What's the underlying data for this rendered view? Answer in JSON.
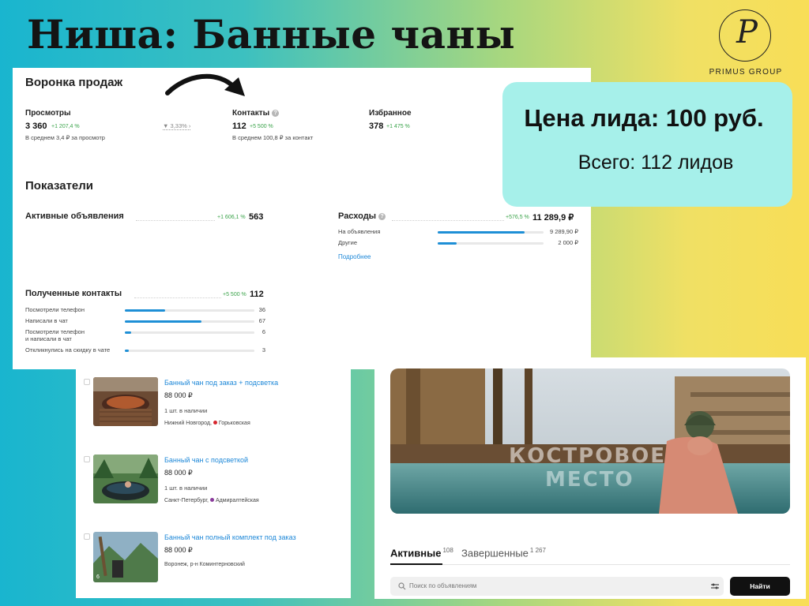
{
  "page": {
    "title": "Ниша: Банные чаны"
  },
  "logo": {
    "letter": "P",
    "text": "PRIMUS GROUP"
  },
  "funnel": {
    "title": "Воронка продаж",
    "views": {
      "label": "Просмотры",
      "value": "3 360",
      "delta": "+1 207,4 %",
      "sub": "В среднем 3,4 ₽ за просмотр"
    },
    "conversion": "3,33%",
    "contacts": {
      "label": "Контакты",
      "value": "112",
      "delta": "+5 500 %",
      "sub": "В среднем 100,8 ₽ за контакт"
    },
    "favorites": {
      "label": "Избранное",
      "value": "378",
      "delta": "+1 475 %"
    }
  },
  "metrics": {
    "title": "Показатели",
    "active_ads": {
      "label": "Активные объявления",
      "delta": "+1 606,1 %",
      "value": "563"
    },
    "expenses": {
      "label": "Расходы",
      "delta": "+576,5 %",
      "value": "11 289,9 ₽",
      "rows": [
        {
          "label": "На объявления",
          "value": "9 289,90 ₽",
          "fraction": 0.82
        },
        {
          "label": "Другие",
          "value": "2 000 ₽",
          "fraction": 0.18
        }
      ],
      "more_link": "Подробнее"
    },
    "contacts": {
      "label": "Полученные контакты",
      "delta": "+5 500 %",
      "value": "112",
      "rows": [
        {
          "label": "Посмотрели телефон",
          "value": "36",
          "fraction": 0.31
        },
        {
          "label": "Написали в чат",
          "value": "67",
          "fraction": 0.59
        },
        {
          "label": "Посмотрели телефон\nи написали в чат",
          "value": "6",
          "fraction": 0.05
        },
        {
          "label": "Откликнулись на скидку в чате",
          "value": "3",
          "fraction": 0.03
        }
      ]
    }
  },
  "lead": {
    "price": "Цена лида: 100 руб.",
    "total": "Всего: 112 лидов"
  },
  "listings": [
    {
      "title": "Банный чан под заказ + подсветка",
      "price": "88 000 ₽",
      "stock": "1 шт. в наличии",
      "city": "Нижний Новгород,",
      "metro": "Горьковская",
      "metro_color": "#d6262e"
    },
    {
      "title": "Банный чан с подсветкой",
      "price": "88 000 ₽",
      "stock": "1 шт. в наличии",
      "city": "Санкт-Петербург,",
      "metro": "Адмиралтейская",
      "metro_color": "#8a3b9c"
    },
    {
      "title": "Банный чан полный комплект под заказ",
      "price": "88 000 ₽",
      "stock": "",
      "city": "Воронеж, р-н Коминтерновский",
      "metro": "",
      "metro_color": "",
      "photo_count": "6"
    }
  ],
  "profile": {
    "hero_watermark_1": "КОСТРОВОЕ",
    "hero_watermark_2": "МЕСТО",
    "tabs": [
      {
        "label": "Активные",
        "count": "108",
        "active": true
      },
      {
        "label": "Завершенные",
        "count": "1 267",
        "active": false
      }
    ],
    "search": {
      "placeholder": "Поиск по объявлениям",
      "button": "Найти"
    }
  }
}
